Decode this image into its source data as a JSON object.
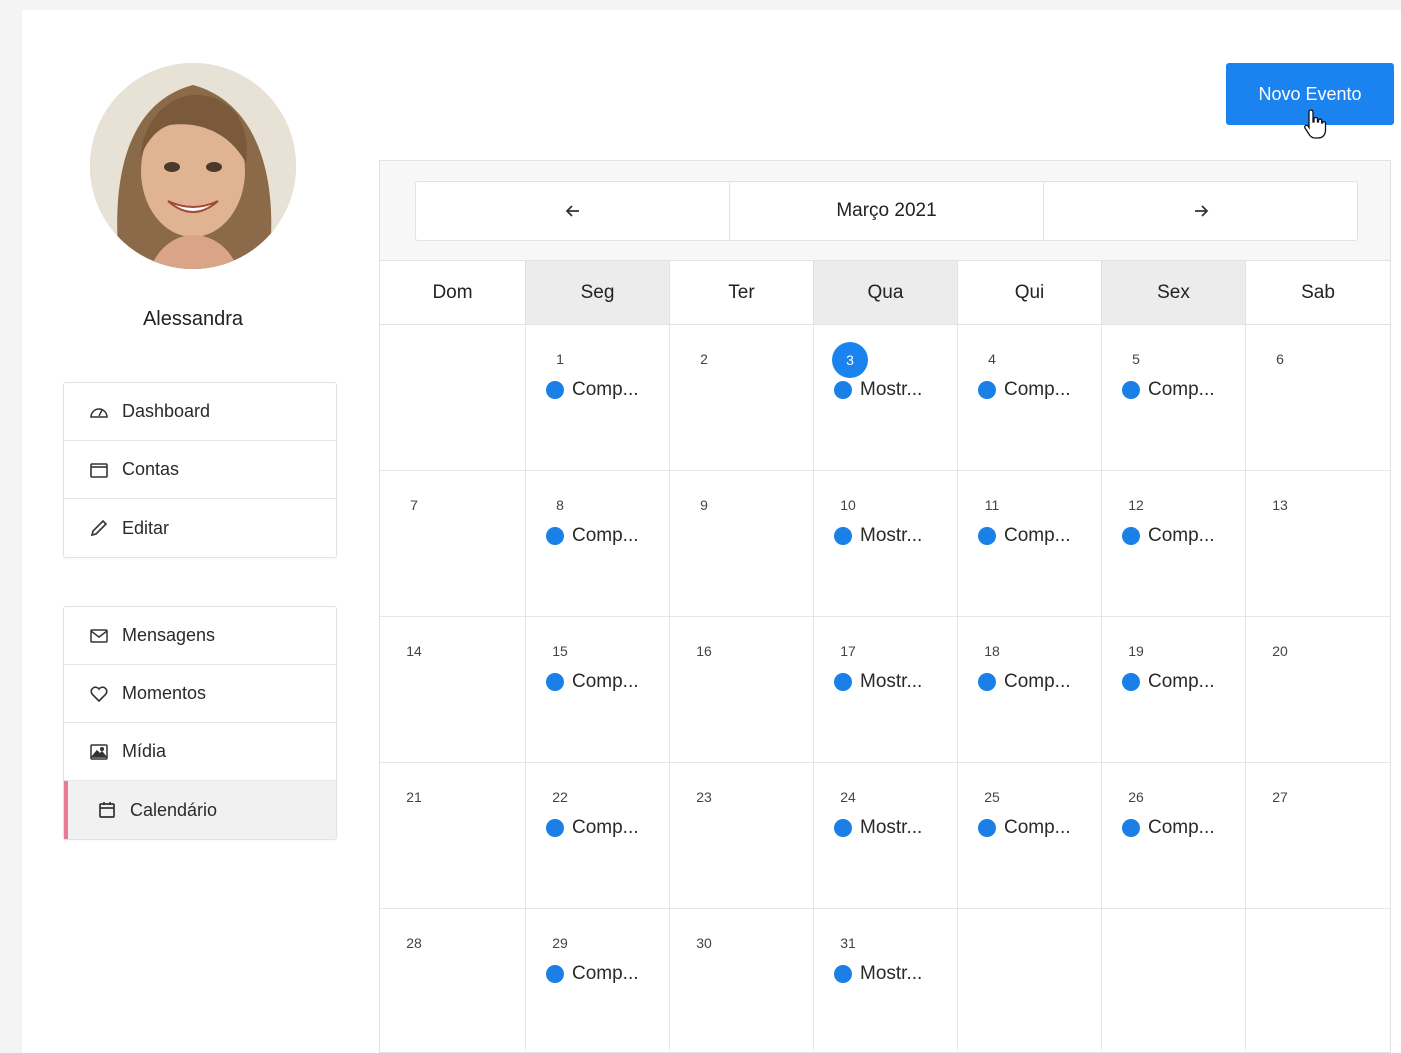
{
  "user": {
    "name": "Alessandra"
  },
  "menu_main": [
    {
      "label": "Dashboard",
      "icon": "dashboard-icon"
    },
    {
      "label": "Contas",
      "icon": "card-icon"
    },
    {
      "label": "Editar",
      "icon": "pencil-icon"
    }
  ],
  "menu_secondary": [
    {
      "label": "Mensagens",
      "icon": "envelope-icon"
    },
    {
      "label": "Momentos",
      "icon": "heart-icon"
    },
    {
      "label": "Mídia",
      "icon": "image-icon"
    },
    {
      "label": "Calendário",
      "icon": "calendar-icon",
      "active": true
    }
  ],
  "header": {
    "new_event_label": "Novo Evento"
  },
  "calendar": {
    "month_label": "Março 2021",
    "days_of_week": [
      "Dom",
      "Seg",
      "Ter",
      "Qua",
      "Qui",
      "Sex",
      "Sab"
    ],
    "highlighted_columns": [
      "Seg",
      "Qua",
      "Sex"
    ],
    "today": "3",
    "weeks": [
      [
        {
          "day": ""
        },
        {
          "day": "1",
          "event": "Comp..."
        },
        {
          "day": "2"
        },
        {
          "day": "3",
          "event": "Mostr..."
        },
        {
          "day": "4",
          "event": "Comp..."
        },
        {
          "day": "5",
          "event": "Comp..."
        },
        {
          "day": "6"
        }
      ],
      [
        {
          "day": "7"
        },
        {
          "day": "8",
          "event": "Comp..."
        },
        {
          "day": "9"
        },
        {
          "day": "10",
          "event": "Mostr..."
        },
        {
          "day": "11",
          "event": "Comp..."
        },
        {
          "day": "12",
          "event": "Comp..."
        },
        {
          "day": "13"
        }
      ],
      [
        {
          "day": "14"
        },
        {
          "day": "15",
          "event": "Comp..."
        },
        {
          "day": "16"
        },
        {
          "day": "17",
          "event": "Mostr..."
        },
        {
          "day": "18",
          "event": "Comp..."
        },
        {
          "day": "19",
          "event": "Comp..."
        },
        {
          "day": "20"
        }
      ],
      [
        {
          "day": "21"
        },
        {
          "day": "22",
          "event": "Comp..."
        },
        {
          "day": "23"
        },
        {
          "day": "24",
          "event": "Mostr..."
        },
        {
          "day": "25",
          "event": "Comp..."
        },
        {
          "day": "26",
          "event": "Comp..."
        },
        {
          "day": "27"
        }
      ],
      [
        {
          "day": "28"
        },
        {
          "day": "29",
          "event": "Comp..."
        },
        {
          "day": "30"
        },
        {
          "day": "31",
          "event": "Mostr..."
        },
        {
          "day": ""
        },
        {
          "day": ""
        },
        {
          "day": ""
        }
      ]
    ]
  },
  "colors": {
    "accent": "#1a83f0",
    "event_dot": "#1a7fe6",
    "active_marker": "#e97a93"
  }
}
